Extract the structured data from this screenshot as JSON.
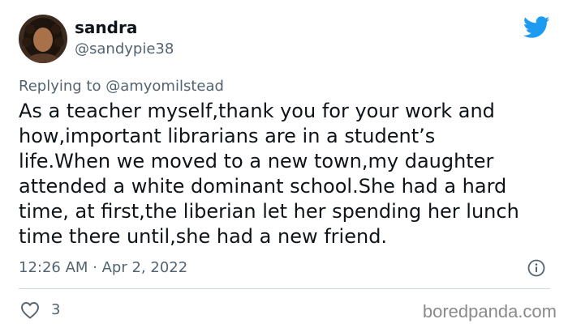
{
  "author": {
    "display_name": "sandra",
    "handle": "@sandypie38"
  },
  "reply": {
    "prefix": "Replying to ",
    "mention": "@amyomilstead"
  },
  "tweet": {
    "lines": [
      "As a teacher myself,thank you for your work and",
      "how,important librarians are in a student’s",
      "life.When we moved to a new town,my daughter",
      "attended a white dominant school.She had a hard",
      "time, at first,the liberian let her spending her lunch",
      "time there until,she had a new friend."
    ],
    "timestamp": "12:26 AM · Apr 2, 2022",
    "like_count": "3"
  },
  "watermark": "boredpanda.com",
  "icons": {
    "brand": "twitter-bird-icon",
    "info": "info-icon",
    "like": "heart-icon"
  },
  "colors": {
    "twitter_blue": "#1d9bf0",
    "text_primary": "#0f1419",
    "text_secondary": "#536471",
    "divider": "#cfd9de"
  }
}
